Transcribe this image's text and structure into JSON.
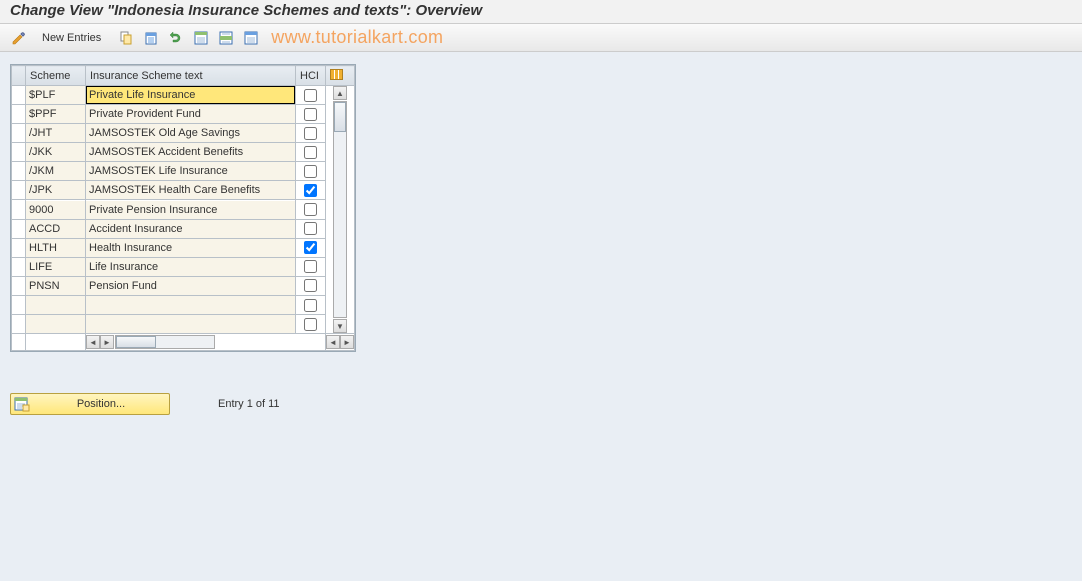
{
  "title": "Change View \"Indonesia Insurance Schemes and texts\": Overview",
  "toolbar": {
    "new_entries_label": "New Entries"
  },
  "watermark": "www.tutorialkart.com",
  "table": {
    "columns": {
      "scheme": "Scheme",
      "text": "Insurance Scheme text",
      "hci": "HCI"
    },
    "rows": [
      {
        "scheme": "$PLF",
        "text": "Private Life Insurance",
        "hci": false,
        "highlighted": true
      },
      {
        "scheme": "$PPF",
        "text": "Private Provident Fund",
        "hci": false
      },
      {
        "scheme": "/JHT",
        "text": "JAMSOSTEK Old Age Savings",
        "hci": false
      },
      {
        "scheme": "/JKK",
        "text": "JAMSOSTEK Accident Benefits",
        "hci": false
      },
      {
        "scheme": "/JKM",
        "text": "JAMSOSTEK Life Insurance",
        "hci": false
      },
      {
        "scheme": "/JPK",
        "text": "JAMSOSTEK Health Care Benefits",
        "hci": true
      },
      {
        "scheme": "9000",
        "text": "Private Pension Insurance",
        "hci": false
      },
      {
        "scheme": "ACCD",
        "text": "Accident Insurance",
        "hci": false
      },
      {
        "scheme": "HLTH",
        "text": "Health Insurance",
        "hci": true
      },
      {
        "scheme": "LIFE",
        "text": "Life Insurance",
        "hci": false
      },
      {
        "scheme": "PNSN",
        "text": "Pension Fund",
        "hci": false
      }
    ],
    "empty_rows": 2
  },
  "footer": {
    "position_label": "Position...",
    "entry_text": "Entry 1 of 11"
  }
}
